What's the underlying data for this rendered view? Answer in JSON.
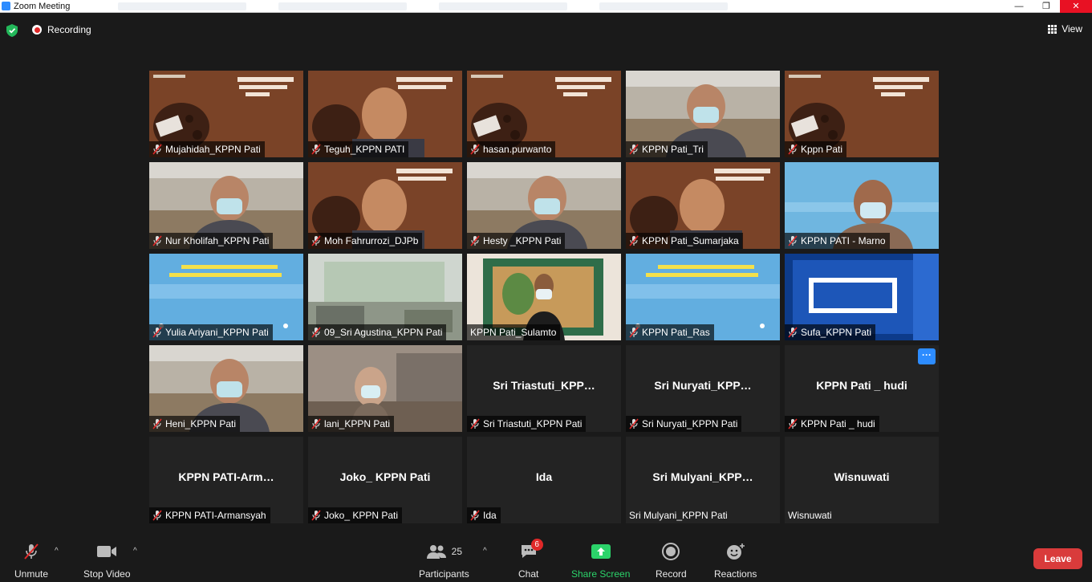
{
  "window": {
    "title": "Zoom Meeting",
    "controls": {
      "minimize": "—",
      "maximize": "❐",
      "close": "✕"
    }
  },
  "topbar": {
    "recording_label": "Recording",
    "view_label": "View"
  },
  "gallery": {
    "tiles": [
      {
        "name": "Mujahidah_KPPN Pati",
        "muted": true,
        "kind": "slide"
      },
      {
        "name": "Teguh_KPPN PATI",
        "muted": true,
        "kind": "slide-person"
      },
      {
        "name": "hasan.purwanto",
        "muted": true,
        "kind": "slide"
      },
      {
        "name": "KPPN Pati_Tri",
        "muted": true,
        "kind": "video"
      },
      {
        "name": "Kppn Pati",
        "muted": true,
        "kind": "slide"
      },
      {
        "name": "Nur Kholifah_KPPN Pati",
        "muted": true,
        "kind": "video"
      },
      {
        "name": "Moh Fahrurrozi_DJPb",
        "muted": true,
        "kind": "slide-person"
      },
      {
        "name": "Hesty _KPPN Pati",
        "muted": true,
        "kind": "video"
      },
      {
        "name": "KPPN Pati_Sumarjaka",
        "muted": true,
        "kind": "slide-person"
      },
      {
        "name": "KPPN PATI - Marno",
        "muted": true,
        "kind": "blue-person"
      },
      {
        "name": "Yulia Ariyani_KPPN Pati",
        "muted": true,
        "kind": "blue"
      },
      {
        "name": "09_Sri Agustina_KPPN Pati",
        "muted": true,
        "kind": "office"
      },
      {
        "name": "KPPN Pati_Sulamto",
        "muted": false,
        "kind": "speaker",
        "active": true
      },
      {
        "name": "KPPN Pati_Ras",
        "muted": true,
        "kind": "blue"
      },
      {
        "name": "Sufa_KPPN Pati",
        "muted": true,
        "kind": "kppn"
      },
      {
        "name": "Heni_KPPN Pati",
        "muted": true,
        "kind": "video"
      },
      {
        "name": "lani_KPPN Pati",
        "muted": true,
        "kind": "office-person"
      },
      {
        "name": "Sri Triastuti_KPPN Pati",
        "display": "Sri  Triastuti_KPP…",
        "muted": true,
        "kind": "empty"
      },
      {
        "name": "Sri Nuryati_KPPN Pati",
        "display": "Sri  Nuryati_KPP…",
        "muted": true,
        "kind": "empty"
      },
      {
        "name": "KPPN Pati _ hudi",
        "display": "KPPN Pati _ hudi",
        "muted": true,
        "kind": "empty",
        "more": "···"
      },
      {
        "name": "KPPN PATI-Armansyah",
        "display": "KPPN  PATI-Arm…",
        "muted": true,
        "kind": "empty"
      },
      {
        "name": "Joko_ KPPN Pati",
        "display": "Joko_ KPPN Pati",
        "muted": true,
        "kind": "empty"
      },
      {
        "name": "Ida",
        "display": "Ida",
        "muted": true,
        "kind": "empty"
      },
      {
        "name": "Sri Mulyani_KPPN Pati",
        "display": "Sri  Mulyani_KPP…",
        "muted": false,
        "kind": "empty"
      },
      {
        "name": "Wisnuwati",
        "display": "Wisnuwati",
        "muted": false,
        "kind": "empty"
      }
    ]
  },
  "toolbar": {
    "unmute": "Unmute",
    "stop_video": "Stop Video",
    "participants": "Participants",
    "participants_count": "25",
    "chat": "Chat",
    "chat_badge": "6",
    "share_screen": "Share Screen",
    "record": "Record",
    "reactions": "Reactions",
    "leave": "Leave",
    "caret": "^"
  },
  "colors": {
    "background": "#1a1a1a",
    "tile": "#232323",
    "active_speaker": "#e6e84b",
    "share_green": "#2bd36a",
    "leave_red": "#d93b3b",
    "accent_blue": "#2d8cff",
    "muted_red": "#e02828"
  }
}
